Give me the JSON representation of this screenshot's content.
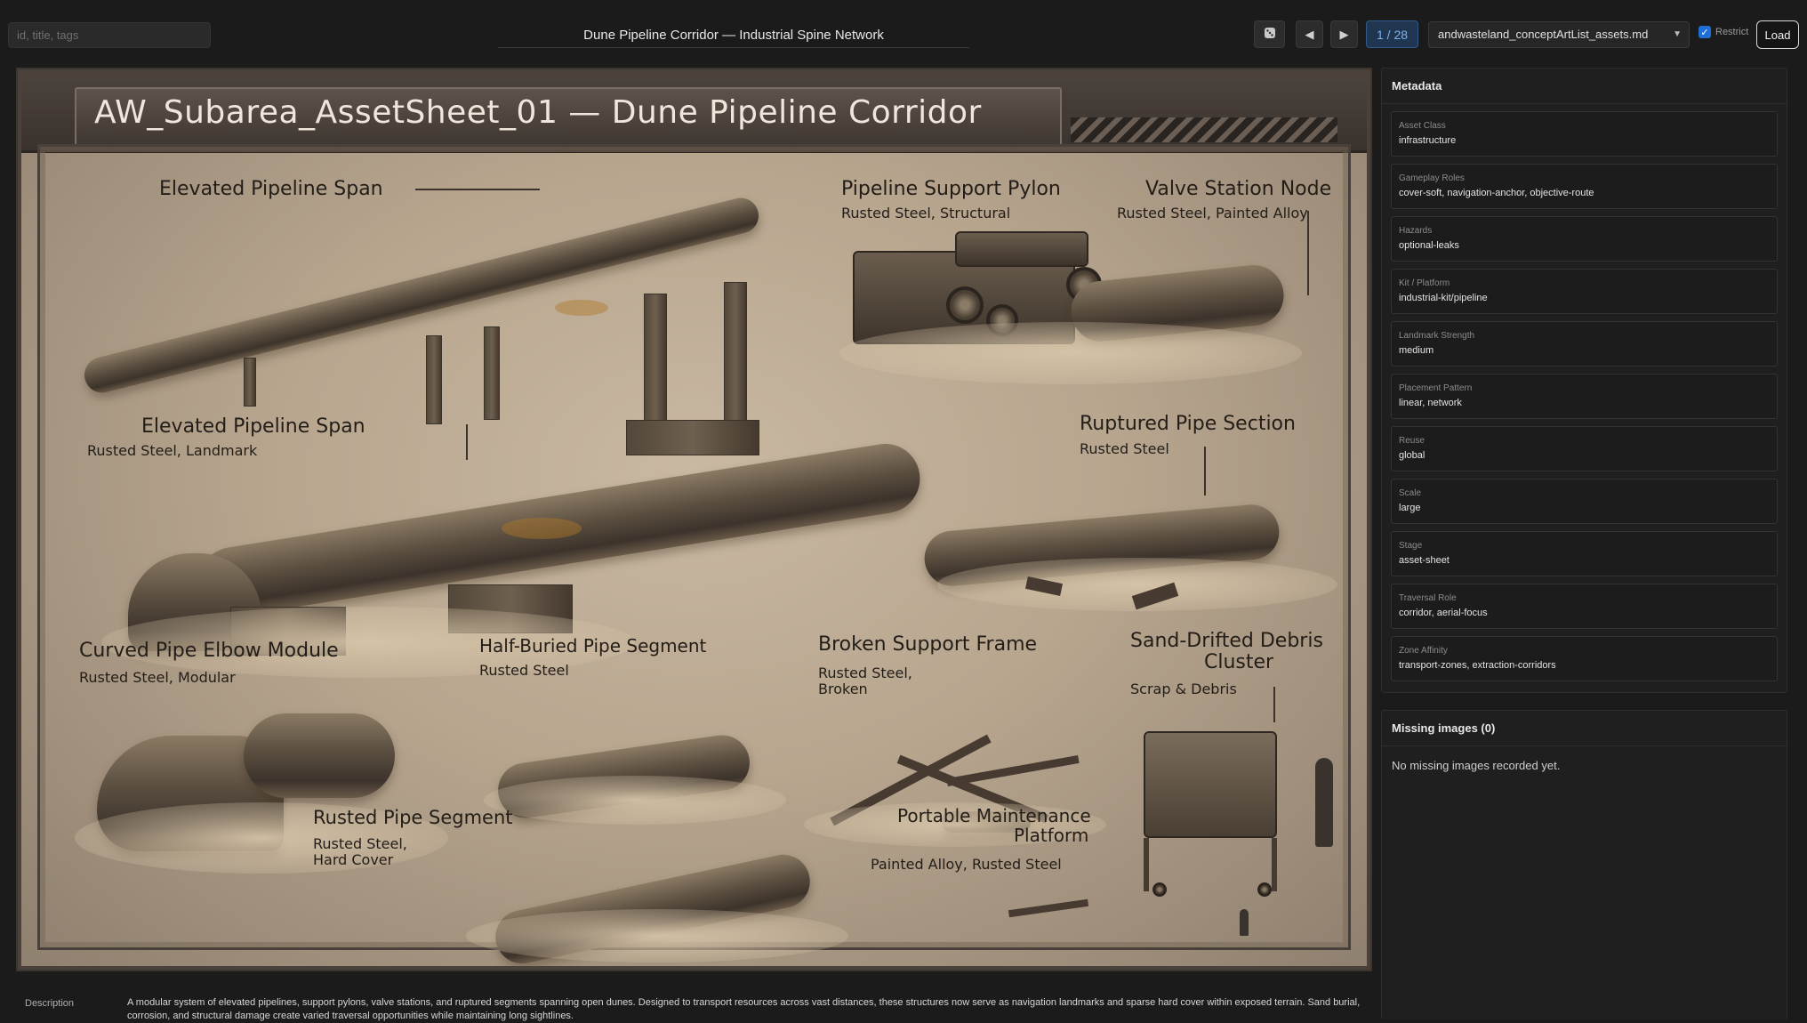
{
  "search": {
    "placeholder": "id, title, tags",
    "value": ""
  },
  "title": "Dune Pipeline Corridor — Industrial Spine Network",
  "toolbar": {
    "pager": "1 / 28",
    "file": "andwasteland_conceptArtList_assets.md",
    "restrict_label": "Restrict",
    "restrict_checked": true,
    "load_label": "Load"
  },
  "sheet": {
    "banner": "AW_Subarea_AssetSheet_01 — Dune Pipeline Corridor",
    "labels": {
      "elevated_span_top": "Elevated Pipeline Span",
      "support_pylon": "Pipeline Support Pylon",
      "support_pylon_sub": "Rusted Steel, Structural",
      "valve_station": "Valve Station Node",
      "valve_station_sub": "Rusted Steel, Painted Alloy",
      "elevated_span_mid": "Elevated Pipeline Span",
      "elevated_span_mid_sub": "Rusted Steel, Landmark",
      "ruptured": "Ruptured Pipe Section",
      "ruptured_sub": "Rusted Steel",
      "elbow": "Curved Pipe Elbow Module",
      "elbow_sub": "Rusted Steel,  Modular",
      "half_buried": "Half-Buried Pipe Segment",
      "half_buried_sub": "Rusted Steel",
      "broken_frame": "Broken Support Frame",
      "broken_frame_sub1": "Rusted Steel,",
      "broken_frame_sub2": "Broken",
      "debris_1": "Sand-Drifted Debris",
      "debris_2": "Cluster",
      "debris_sub": "Scrap & Debris",
      "rusted_segment": "Rusted Pipe Segment",
      "rusted_segment_sub1": "Rusted Steel,",
      "rusted_segment_sub2": "Hard Cover",
      "platform_1": "Portable Maintenance",
      "platform_2": "Platform",
      "platform_sub": "Painted Alloy, Rusted Steel"
    }
  },
  "description": {
    "label": "Description",
    "text": "A modular system of elevated pipelines, support pylons, valve stations, and ruptured segments spanning open dunes. Designed to transport resources across vast distances, these structures now serve as navigation landmarks and sparse hard cover within exposed terrain. Sand burial, corrosion, and structural damage create varied traversal opportunities while maintaining long sightlines."
  },
  "metadata": {
    "heading": "Metadata",
    "items": [
      {
        "key": "Asset Class",
        "value": "infrastructure"
      },
      {
        "key": "Gameplay Roles",
        "value": "cover-soft, navigation-anchor, objective-route"
      },
      {
        "key": "Hazards",
        "value": "optional-leaks"
      },
      {
        "key": "Kit / Platform",
        "value": "industrial-kit/pipeline"
      },
      {
        "key": "Landmark Strength",
        "value": "medium"
      },
      {
        "key": "Placement Pattern",
        "value": "linear, network"
      },
      {
        "key": "Reuse",
        "value": "global"
      },
      {
        "key": "Scale",
        "value": "large"
      },
      {
        "key": "Stage",
        "value": "asset-sheet"
      },
      {
        "key": "Traversal Role",
        "value": "corridor, aerial-focus"
      },
      {
        "key": "Zone Affinity",
        "value": "transport-zones, extraction-corridors"
      }
    ]
  },
  "missing": {
    "heading": "Missing images (0)",
    "message": "No missing images recorded yet."
  },
  "icons": {
    "random": "dice-icon",
    "prev": "triangle-left-icon",
    "next": "triangle-right-icon",
    "check": "checkmark-icon"
  }
}
